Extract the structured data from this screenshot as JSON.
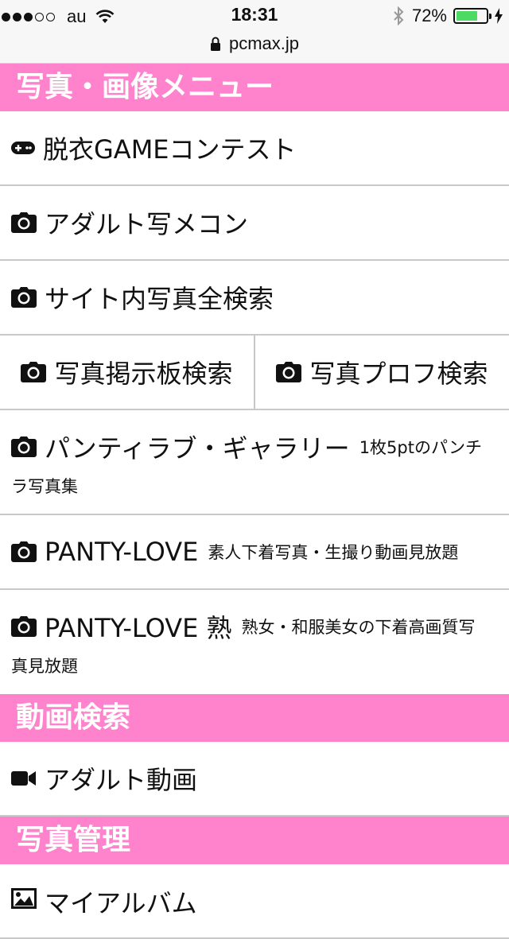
{
  "status": {
    "carrier": "au",
    "time": "18:31",
    "battery_percent": "72%",
    "battery_level": 0.72,
    "url": "pcmax.jp"
  },
  "sections": {
    "photo_menu_title": "写真・画像メニュー",
    "video_search_title": "動画検索",
    "photo_manage_title": "写真管理"
  },
  "items": {
    "game_contest": "脱衣GAMEコンテスト",
    "adult_photo_contest": "アダルト写メコン",
    "site_photo_search": "サイト内写真全検索",
    "board_photo_search": "写真掲示板検索",
    "profile_photo_search": "写真プロフ検索",
    "panty_gallery": "パンティラブ・ギャラリー",
    "panty_gallery_desc_1": "1枚5ptのパンチ",
    "panty_gallery_desc_2": "ラ写真集",
    "panty_love": "PANTY-LOVE",
    "panty_love_desc": "素人下着写真・生撮り動画見放題",
    "panty_love_mature": "PANTY-LOVE 熟",
    "panty_love_mature_desc_1": "熟女・和服美女の下着高画質写",
    "panty_love_mature_desc_2": "真見放題",
    "adult_video": "アダルト動画",
    "my_album": "マイアルバム"
  },
  "colors": {
    "section_bg": "#ff82cd",
    "battery_green": "#4cd964"
  },
  "icons": {
    "gamepad": "gamepad-icon",
    "camera": "camera-icon",
    "video": "video-camera-icon",
    "image": "image-icon"
  }
}
